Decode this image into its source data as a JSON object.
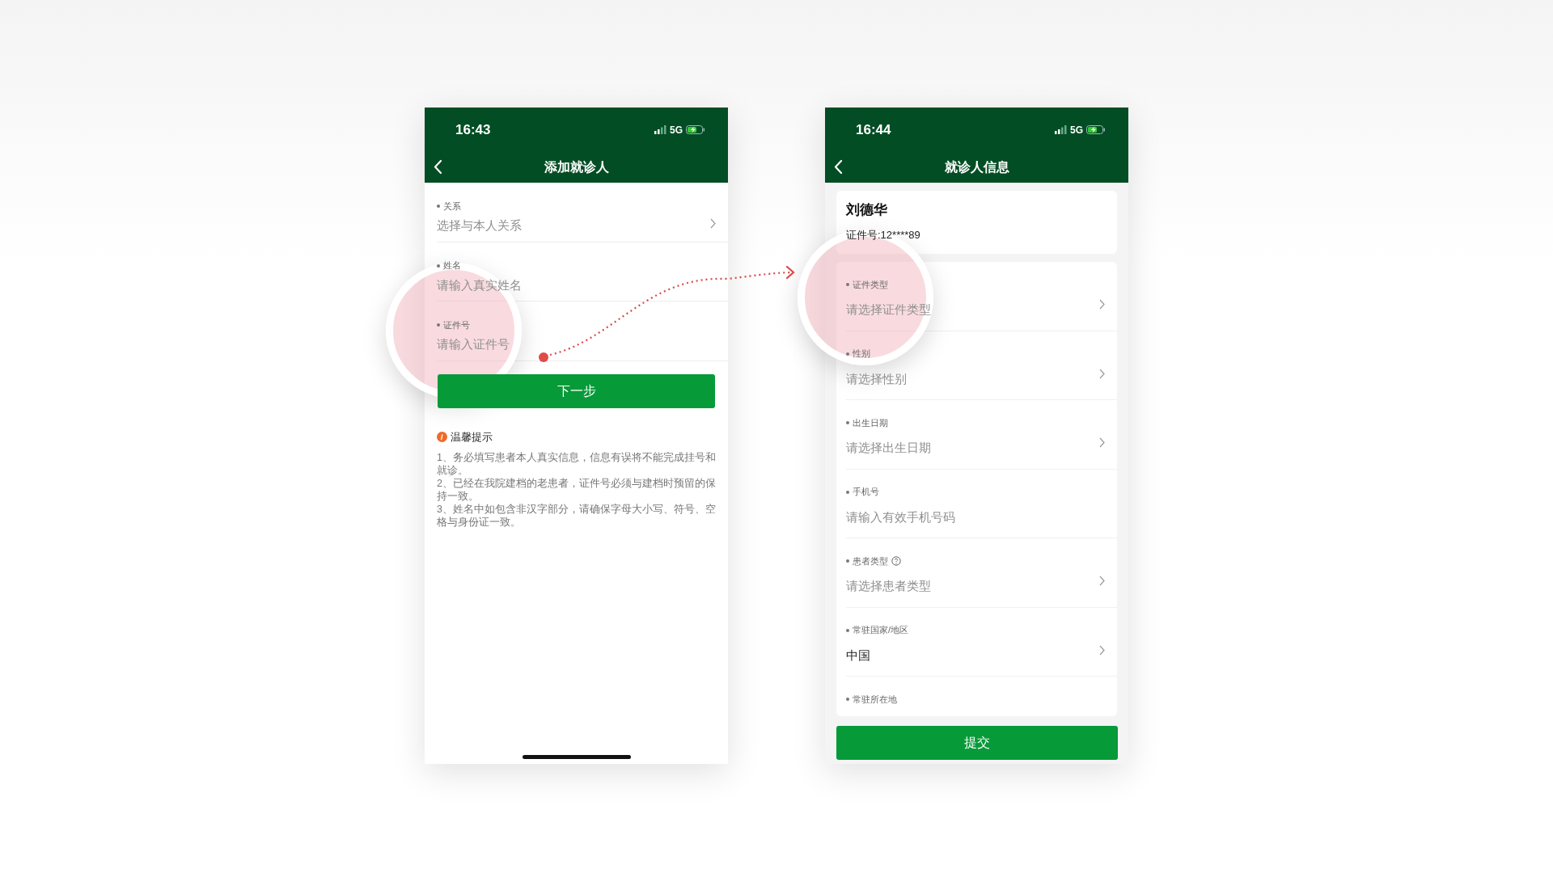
{
  "screens": [
    {
      "time": "16:43",
      "network": "5G",
      "title": "添加就诊人",
      "fields": [
        {
          "label": "关系",
          "placeholder": "选择与本人关系",
          "kind": "select",
          "highlighted": false
        },
        {
          "label": "姓名",
          "placeholder": "请输入真实姓名",
          "kind": "input",
          "highlighted": false
        },
        {
          "label": "证件号",
          "placeholder": "请输入证件号",
          "kind": "input",
          "highlighted": true
        }
      ],
      "button": "下一步",
      "tips": {
        "title": "温馨提示",
        "items": [
          "1、务必填写患者本人真实信息，信息有误将不能完成挂号和就诊。",
          "2、已经在我院建档的老患者，证件号必须与建档时预留的保持一致。",
          "3、姓名中如包含非汉字部分，请确保字母大小写、符号、空格与身份证一致。"
        ]
      }
    },
    {
      "time": "16:44",
      "network": "5G",
      "title": "就诊人信息",
      "patient": {
        "name": "刘德华",
        "id_number": "证件号:12****89"
      },
      "fields": [
        {
          "label": "证件类型",
          "placeholder": "请选择证件类型",
          "kind": "select",
          "highlighted": true
        },
        {
          "label": "性别",
          "placeholder": "请选择性别",
          "kind": "select",
          "highlighted": false
        },
        {
          "label": "出生日期",
          "placeholder": "请选择出生日期",
          "kind": "select",
          "highlighted": false
        },
        {
          "label": "手机号",
          "placeholder": "请输入有效手机号码",
          "kind": "input",
          "highlighted": false
        },
        {
          "label": "患者类型",
          "placeholder": "请选择患者类型",
          "kind": "select",
          "help": true,
          "highlighted": false
        },
        {
          "label": "常驻国家/地区",
          "value": "中国",
          "kind": "select",
          "highlighted": false
        },
        {
          "label": "常驻所在地",
          "kind": "label",
          "highlighted": false
        }
      ],
      "button": "提交"
    }
  ]
}
